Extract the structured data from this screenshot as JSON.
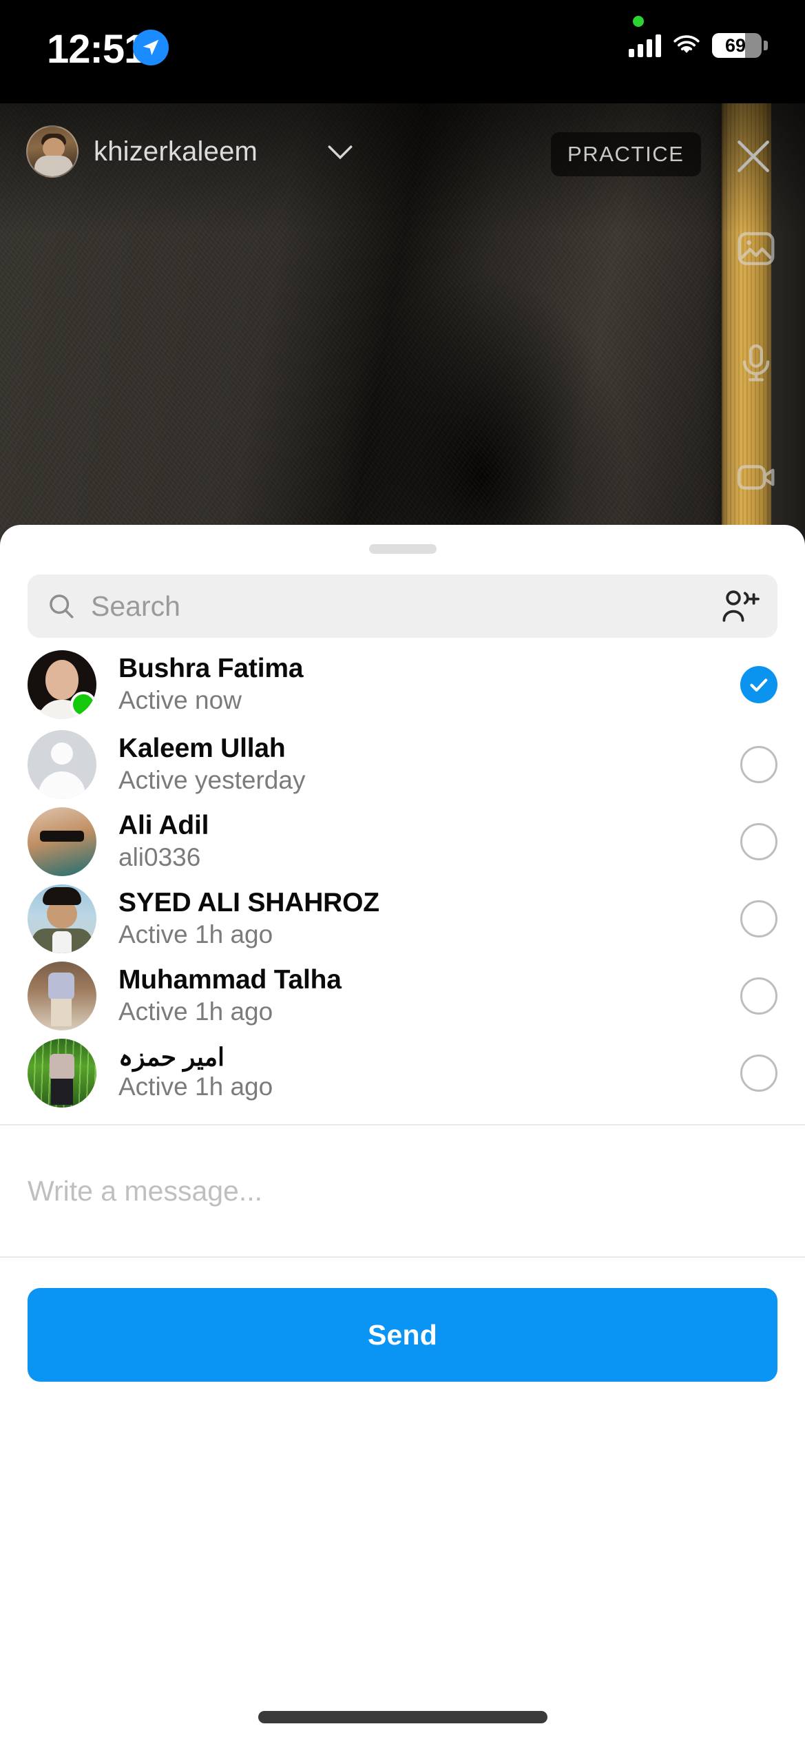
{
  "status_bar": {
    "time": "12:51",
    "location_icon": "location-arrow-icon",
    "cellular_icon": "cellular-bars-icon",
    "wifi_icon": "wifi-icon",
    "battery_level": "69",
    "battery_percent": 69
  },
  "story": {
    "username": "khizerkaleem",
    "chevron_icon": "chevron-down-icon",
    "badge_label": "PRACTICE",
    "close_icon": "close-x-icon",
    "rail_icons": [
      "photo-icon",
      "microphone-icon",
      "video-camera-icon"
    ]
  },
  "sheet": {
    "grab_handle": "grab-handle",
    "search": {
      "placeholder": "Search",
      "icon": "search-icon",
      "add_people_icon": "add-people-icon"
    },
    "recipients": [
      {
        "name": "Bushra Fatima",
        "status": "Active now",
        "selected": true,
        "online": true,
        "avatar": "av-bushra"
      },
      {
        "name": "Kaleem Ullah",
        "status": "Active yesterday",
        "selected": false,
        "online": false,
        "avatar": "av-kaleem"
      },
      {
        "name": "Ali Adil",
        "status": "ali0336",
        "selected": false,
        "online": false,
        "avatar": "av-ali"
      },
      {
        "name": "SYED ALI SHAHROZ",
        "status": "Active 1h ago",
        "selected": false,
        "online": false,
        "avatar": "av-syed"
      },
      {
        "name": "Muhammad Talha",
        "status": "Active 1h ago",
        "selected": false,
        "online": false,
        "avatar": "av-talha"
      },
      {
        "name": "امیر حمزہ",
        "status": "Active 1h ago",
        "selected": false,
        "online": false,
        "avatar": "av-hamza"
      }
    ],
    "message": {
      "placeholder": "Write a message..."
    },
    "send_label": "Send"
  },
  "colors": {
    "accent_blue": "#0a95f4",
    "selected_blue": "#0a93ef",
    "online_green": "#13c90a",
    "search_bg": "#efefef",
    "secondary_text": "#7b7b7b",
    "wood_tan": "#d6a948"
  }
}
